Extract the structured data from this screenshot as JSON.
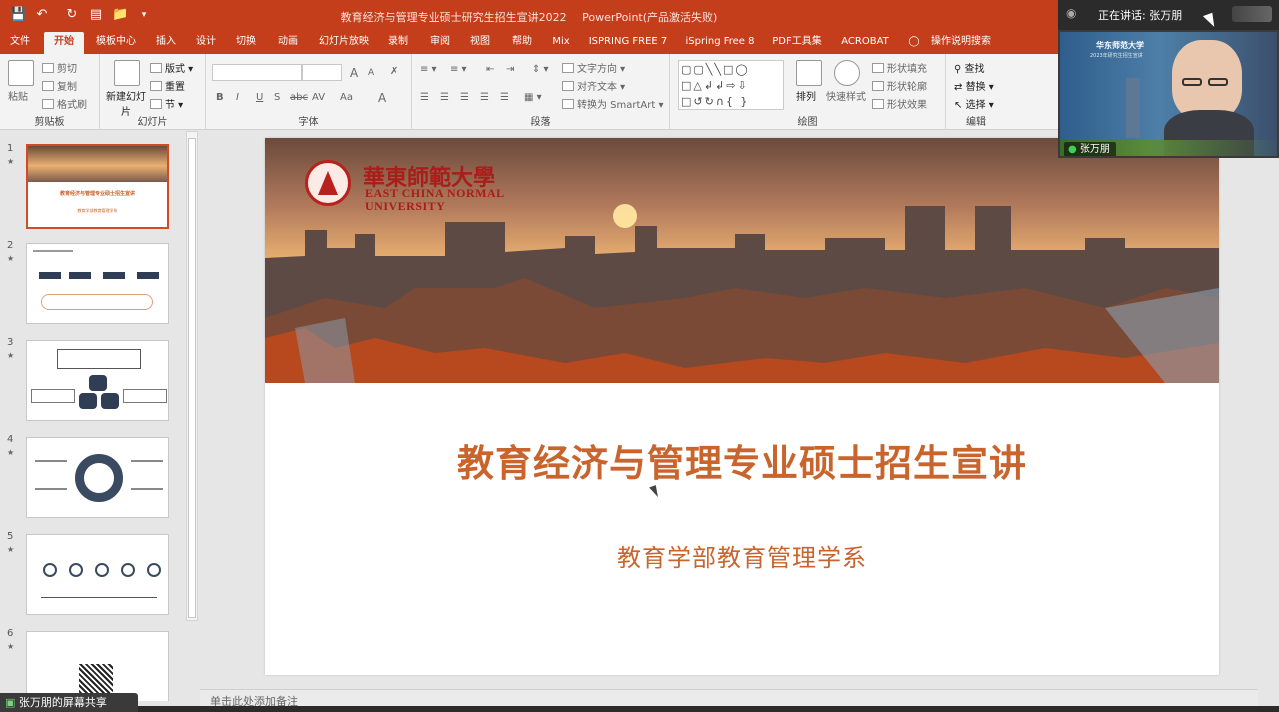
{
  "window": {
    "title": "教育经济与管理专业硕士研究生招生宣讲2022",
    "app": "PowerPoint(产品激活失败)"
  },
  "tabs": [
    "文件",
    "开始",
    "模板中心",
    "插入",
    "设计",
    "切换",
    "动画",
    "幻灯片放映",
    "录制",
    "审阅",
    "视图",
    "帮助",
    "Mix",
    "ISPRING FREE 7",
    "iSpring Free 8",
    "PDF工具集",
    "ACROBAT",
    "操作说明搜索"
  ],
  "active_tab": "开始",
  "ribbon": {
    "clipboard": {
      "label": "剪贴板",
      "paste": "粘贴",
      "cut": "剪切",
      "copy": "复制",
      "format_painter": "格式刷"
    },
    "slides": {
      "label": "幻灯片",
      "new_slide": "新建幻灯片",
      "layout": "版式",
      "reset": "重置",
      "section": "节"
    },
    "font": {
      "label": "字体",
      "bold": "B",
      "italic": "I",
      "underline": "U",
      "strike": "S",
      "shadow": "abc",
      "spacing": "AV",
      "case": "Aa",
      "color": "A",
      "grow": "A",
      "shrink": "A"
    },
    "paragraph": {
      "label": "段落",
      "text_direction": "文字方向",
      "align_text": "对齐文本",
      "smartart": "转换为 SmartArt"
    },
    "drawing": {
      "label": "绘图",
      "arrange": "排列",
      "quick_styles": "快速样式",
      "shape_fill": "形状填充",
      "shape_outline": "形状轮廓",
      "shape_effects": "形状效果"
    },
    "editing": {
      "label": "编辑",
      "find": "查找",
      "replace": "替换",
      "select": "选择"
    }
  },
  "thumbnails": [
    {
      "num": "1",
      "star": "★",
      "title": "教育经济与管理专业硕士招生宣讲",
      "subtitle": "教育学部教育管理学系"
    },
    {
      "num": "2",
      "star": "★"
    },
    {
      "num": "3",
      "star": "★"
    },
    {
      "num": "4",
      "star": "★"
    },
    {
      "num": "5",
      "star": "★"
    },
    {
      "num": "6",
      "star": "★"
    }
  ],
  "slide": {
    "logo_cn": "華東師範大學",
    "logo_en1": "EAST CHINA NORMAL",
    "logo_en2": "UNIVERSITY",
    "title": "教育经济与管理专业硕士招生宣讲",
    "subtitle": "教育学部教育管理学系",
    "accent": "#c8642c"
  },
  "notes_placeholder": "单击此处添加备注",
  "meeting": {
    "speaking_label": "正在讲话: 张万朋",
    "participant": "张万朋",
    "screen_share": "张万朋的屏幕共享",
    "backdrop_school": "华东师范大学",
    "backdrop_line": "2023年研究生招生宣讲"
  },
  "colors": {
    "ribbon_red": "#c43e1c",
    "title_orange": "#c8642c"
  }
}
